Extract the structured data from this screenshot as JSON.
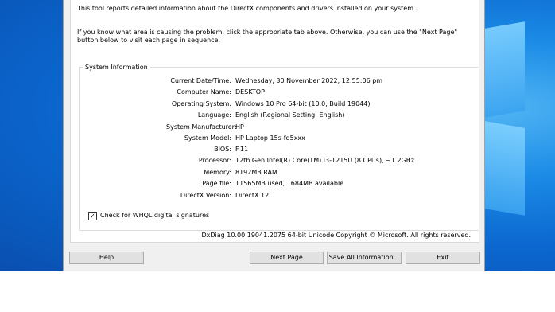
{
  "intro": {
    "line1": "This tool reports detailed information about the DirectX components and drivers installed on your system.",
    "line2": "If you know what area is causing the problem, click the appropriate tab above.  Otherwise, you can use the \"Next Page\" button below to visit each page in sequence."
  },
  "system_information": {
    "title": "System Information",
    "rows": [
      {
        "label": "Current Date/Time:",
        "value": "Wednesday, 30 November 2022, 12:55:06 pm"
      },
      {
        "label": "Computer Name:",
        "value": "DESKTOP"
      },
      {
        "label": "Operating System:",
        "value": "Windows 10 Pro 64-bit (10.0, Build 19044)"
      },
      {
        "label": "Language:",
        "value": "English (Regional Setting: English)"
      },
      {
        "label": "System Manufacturer:",
        "value": "HP"
      },
      {
        "label": "System Model:",
        "value": "HP Laptop 15s-fq5xxx"
      },
      {
        "label": "BIOS:",
        "value": "F.11"
      },
      {
        "label": "Processor:",
        "value": "12th Gen Intel(R) Core(TM) i3-1215U (8 CPUs), ~1.2GHz"
      },
      {
        "label": "Memory:",
        "value": "8192MB RAM"
      },
      {
        "label": "Page file:",
        "value": "11565MB used, 1684MB available"
      },
      {
        "label": "DirectX Version:",
        "value": "DirectX 12"
      }
    ]
  },
  "whql": {
    "label": "Check for WHQL digital signatures",
    "checked": true,
    "check_glyph": "✓"
  },
  "copyright": "DxDiag 10.00.19041.2075 64-bit Unicode  Copyright © Microsoft. All rights reserved.",
  "buttons": {
    "help": "Help",
    "next": "Next Page",
    "save": "Save All Information...",
    "exit": "Exit"
  }
}
